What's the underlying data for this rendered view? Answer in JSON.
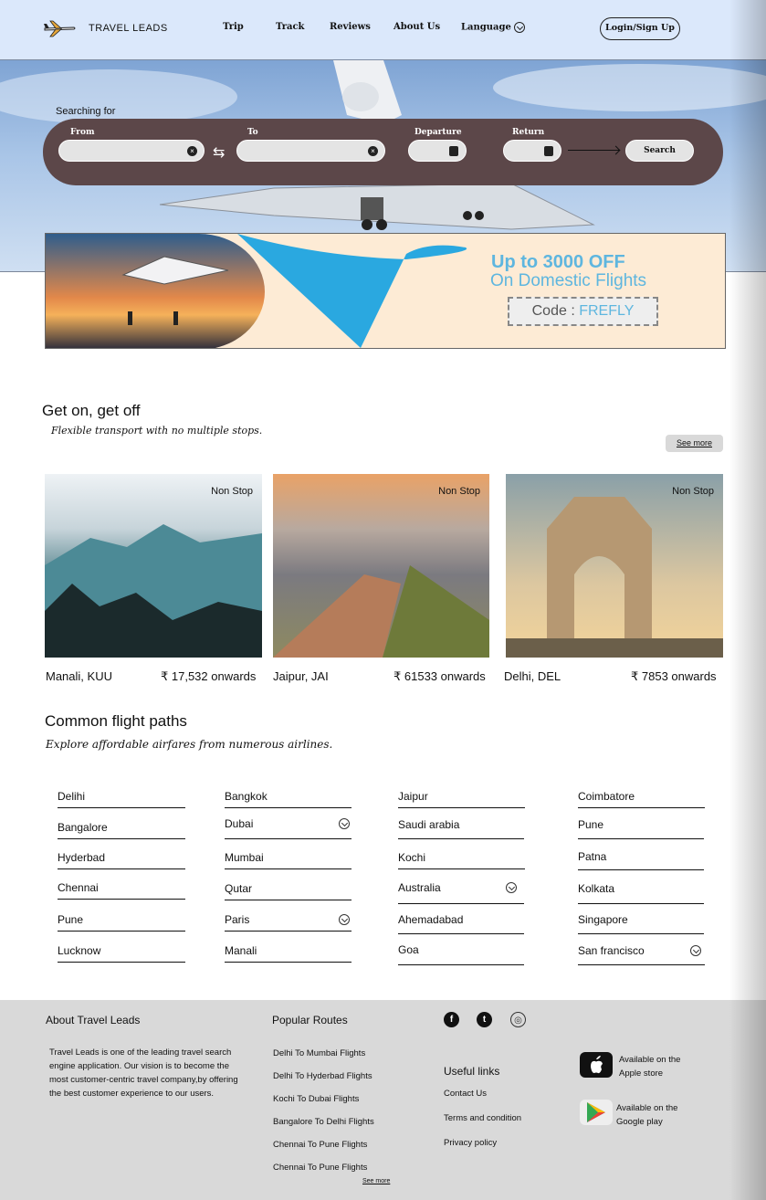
{
  "header": {
    "brand": "TRAVEL LEADS",
    "nav": [
      "Trip",
      "Track",
      "Reviews",
      "About Us",
      "Language"
    ],
    "login": "Login/Sign Up"
  },
  "search": {
    "heading": "Searching for",
    "from_label": "From",
    "to_label": "To",
    "departure_label": "Departure",
    "return_label": "Return",
    "button": "Search"
  },
  "promo": {
    "line1": "Up to 3000 OFF",
    "line2": "On Domestic Flights",
    "code_prefix": "Code : ",
    "code": "FREFLY"
  },
  "destinations": {
    "title": "Get on, get off",
    "subtitle": "Flexible transport with no multiple stops.",
    "see_more": "See more",
    "cards": [
      {
        "badge": "Non Stop",
        "name": "Manali, KUU",
        "price": "₹ 17,532 onwards"
      },
      {
        "badge": "Non Stop",
        "name": "Jaipur, JAI",
        "price": "₹ 61533 onwards"
      },
      {
        "badge": "Non Stop",
        "name": "Delhi, DEL",
        "price": "₹ 7853 onwards"
      }
    ]
  },
  "paths": {
    "title": "Common flight paths",
    "subtitle": "Explore  affordable airfares from numerous airlines.",
    "columns": [
      [
        "Delihi",
        "Bangalore",
        "Hyderbad",
        "Chennai",
        "Pune",
        "Lucknow"
      ],
      [
        "Bangkok",
        "Dubai",
        "Mumbai",
        "Qutar",
        "Paris",
        "Manali"
      ],
      [
        "Jaipur",
        "Saudi arabia",
        "Kochi",
        "Australia",
        "Ahemadabad",
        "Goa"
      ],
      [
        "Coimbatore",
        "Pune",
        "Patna",
        "Kolkata",
        "Singapore",
        "San francisco"
      ]
    ]
  },
  "footer": {
    "about_title": "About Travel Leads",
    "about_text": "Travel Leads is one of the leading travel search engine application. Our vision is to become the most customer-centric travel company,by offering the best customer experience to our users.",
    "routes_title": "Popular Routes",
    "routes": [
      "Delhi To Mumbai Flights",
      "Delhi To Hyderbad Flights",
      "Kochi To Dubai Flights",
      "Bangalore To Delhi Flights",
      "Chennai To Pune Flights",
      "Chennai To Pune Flights"
    ],
    "see_more": "See more",
    "useful_title": "Useful links",
    "useful": [
      "Contact Us",
      "Terms and condition",
      "Privacy policy"
    ],
    "apple": "Available on the Apple store",
    "google": "Available on the Google play",
    "social_icons": [
      "facebook-icon",
      "twitter-icon",
      "instagram-icon"
    ]
  },
  "colors": {
    "header_bg": "#dbe8fb",
    "search_bar": "#5c4749",
    "promo_accent": "#5eb6df",
    "footer_bg": "#d9d9d9"
  }
}
